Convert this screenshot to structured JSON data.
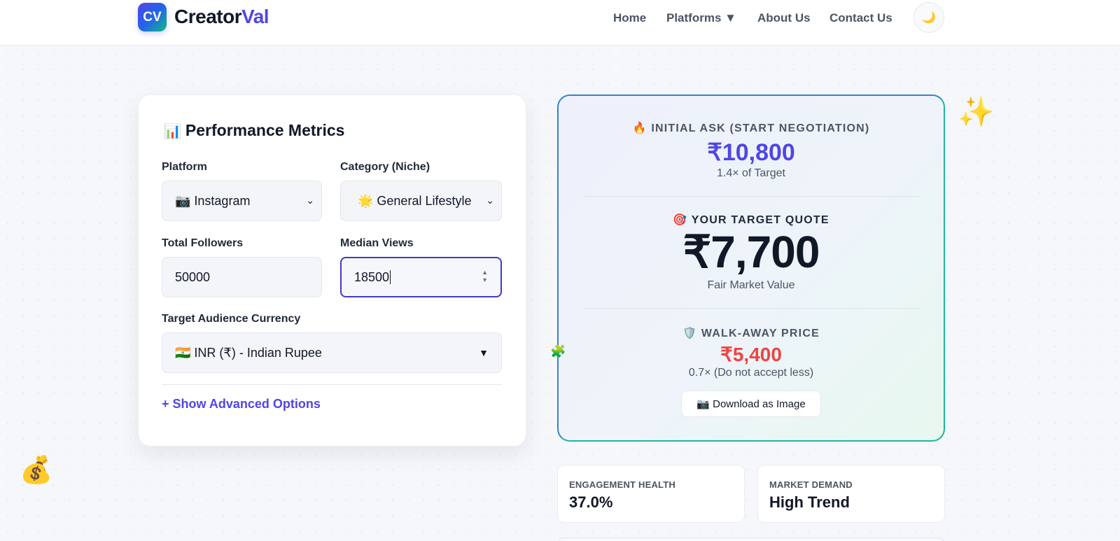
{
  "header": {
    "logo_badge": "CV",
    "logo_main": "Creator",
    "logo_accent": "Val",
    "nav": {
      "home": "Home",
      "platforms": "Platforms ▼",
      "about": "About Us",
      "contact": "Contact Us"
    },
    "theme_icon": "🌙"
  },
  "form": {
    "title_icon": "📊",
    "title": "Performance Metrics",
    "platform_label": "Platform",
    "platform_value": "📷 Instagram",
    "category_label": "Category (Niche)",
    "category_value": "🌟 General Lifestyle",
    "followers_label": "Total Followers",
    "followers_value": "50000",
    "views_label": "Median Views",
    "views_value": "18500",
    "currency_label": "Target Audience Currency",
    "currency_value": "🇮🇳 INR (₹) - Indian Rupee",
    "advanced_link": "+ Show Advanced Options"
  },
  "quote": {
    "initial_icon": "🔥",
    "initial_heading": "INITIAL ASK (START NEGOTIATION)",
    "initial_value": "₹10,800",
    "initial_sub": "1.4× of Target",
    "target_icon": "🎯",
    "target_heading": "YOUR TARGET QUOTE",
    "target_value": "₹7,700",
    "target_sub": "Fair Market Value",
    "walk_icon": "🛡️",
    "walk_heading": "WALK-AWAY PRICE",
    "walk_value": "₹5,400",
    "walk_sub": "0.7× (Do not accept less)",
    "download_label": "📷 Download as Image"
  },
  "stats": {
    "engagement_label": "ENGAGEMENT HEALTH",
    "engagement_value": "37.0%",
    "demand_label": "MARKET DEMAND",
    "demand_value": "High Trend"
  },
  "decor": {
    "sparkle": "✨",
    "money": "💰",
    "piece": "🧩"
  },
  "colors": {
    "accent": "#4f46e5",
    "walk_away": "#ef4444"
  }
}
